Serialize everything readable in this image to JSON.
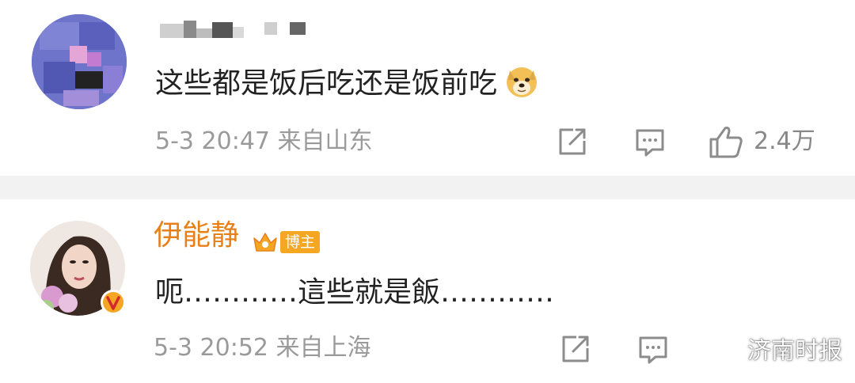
{
  "comments": [
    {
      "text": "这些都是饭后吃还是饭前吃",
      "emoji": "doge-emoji",
      "time": "5-3 20:47",
      "location": "来自山东",
      "likes": "2.4万"
    },
    {
      "username": "伊能静",
      "badge": "博主",
      "text": "呃…………這些就是飯…………",
      "time": "5-3 20:52",
      "location": "来自上海"
    }
  ],
  "watermark": "济南时报",
  "colors": {
    "username": "#e8801a",
    "badge": "#f5a623",
    "meta": "#9a9a9a",
    "divider": "#f2f2f2"
  }
}
